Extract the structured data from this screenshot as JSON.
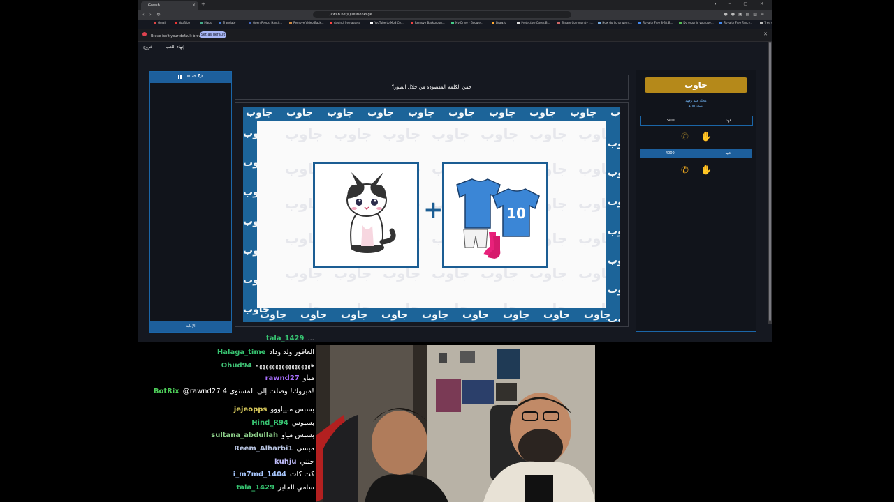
{
  "browser": {
    "tab_title": "Gwesb",
    "url": "jawab.net/QuestionPage",
    "bookmarks": [
      "Gmail",
      "YouTube",
      "Maps",
      "Translate",
      "Open Peeps, Hand-...",
      "Remove Video Back...",
      "davinci free assets",
      "YouTube to Mp3 Co...",
      "Remove Backgroun...",
      "My Drive - Google...",
      "Draw.io",
      "Protective Cases B...",
      "Steam Community ::...",
      "How do I change m...",
      "Royalty Free 8-Bit B...",
      "Do organic youtube...",
      "Royalty Free Fancy...",
      "Tree view React com..."
    ],
    "infobar_message": "Brave isn't your default browser",
    "infobar_button": "Set as default"
  },
  "game": {
    "nav": {
      "exit": "خروج",
      "end_game": "إنهاء اللعب"
    },
    "timer": "00:28",
    "answer_label": "الإجابة",
    "question": "خمن الكلمة المقصودة من خلال الصور؟",
    "logo_text": "جاوب",
    "team_info_line1": "مخلة فهد وفهد",
    "team_info_line2": "400 نقطة",
    "teams": [
      {
        "name": "فهد",
        "score": "3400",
        "style": "outline"
      },
      {
        "name": "فهد",
        "score": "4000",
        "style": "filled"
      }
    ],
    "watermark": "جاوب",
    "plus": "+",
    "jersey_number": "10"
  },
  "chat": {
    "messages": [
      {
        "user": "tala_1429",
        "text": "...",
        "color": "#37c471"
      },
      {
        "user": "Halaga_time",
        "text": "العافور ولد وداد",
        "color": "#37c471"
      },
      {
        "user": "Ohud94",
        "text": "هههههههههههههههههه",
        "color": "#3fbf74"
      },
      {
        "user": "rawnd27",
        "text": "مياو",
        "color": "#a970ff"
      },
      {
        "user": "BotRix",
        "text": "@rawnd27 مبروك! وصلت إلى المستوى 4!",
        "color": "#4ecf5a"
      },
      {
        "user": "jejeopps",
        "text": "بسبس مبيياووو",
        "color": "#d8c95b"
      },
      {
        "user": "Hind_R94",
        "text": "بسبوس",
        "color": "#37c471"
      },
      {
        "user": "sultana_abdullah",
        "text": "بسبس مياو",
        "color": "#8ed18b"
      },
      {
        "user": "Reem_Alharbi1",
        "text": "ميسي",
        "color": "#b7c3e0"
      },
      {
        "user": "kuhju",
        "text": "حنني",
        "color": "#c3c0ff"
      },
      {
        "user": "i_m7md_1404",
        "text": "كت كات",
        "color": "#a9c8ff"
      },
      {
        "user": "tala_1429",
        "text": "سامي الجابر",
        "color": "#37c471"
      }
    ]
  },
  "colors": {
    "accent": "#1d5f9c",
    "gold": "#b5891a",
    "lifeline": "#e8a51f"
  }
}
